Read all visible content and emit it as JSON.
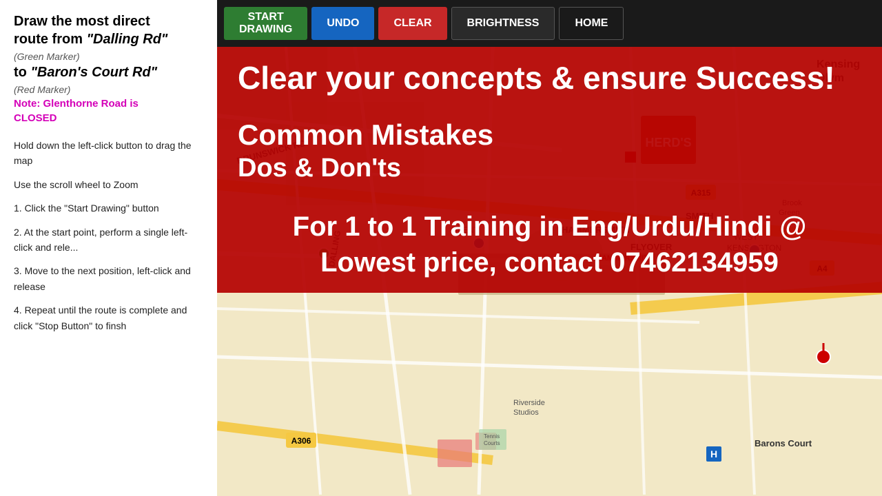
{
  "left_panel": {
    "title_line1": "Draw the most direct",
    "title_line2": "route from ",
    "from_place": "\"Dalling Rd\"",
    "from_marker": "(Green Marker)",
    "to_word": "to ",
    "to_place": "\"Baron's Court Rd\"",
    "to_marker": "(Red Marker)",
    "note_label": "Note: Glenthorne Road is",
    "note_closed": "CLOSED",
    "step_drag": "Hold down the left-click button to drag the map",
    "step_zoom": "Use the scroll wheel to Zoom",
    "step1": "1. Click the \"Start Drawing\" button",
    "step2": "2. At the start point, perform a single left-click and rele...",
    "step3": "3. Move to the next position, left-click and release",
    "step4": "4. Repeat until the route is complete and click \"Stop Button\" to finsh"
  },
  "toolbar": {
    "start_drawing": "START\nDRAWING",
    "undo": "UNDO",
    "clear": "CLEAR",
    "brightness": "BRIGHTNESS",
    "home": "HOME"
  },
  "overlay": {
    "line1": "Clear your concepts & ensure Success!",
    "line2": "Common Mistakes",
    "line3": "Dos & Don'ts",
    "contact_line1": "For 1 to 1 Training in Eng/Urdu/Hindi @",
    "contact_line2": "Lowest price, contact 07462134959"
  }
}
